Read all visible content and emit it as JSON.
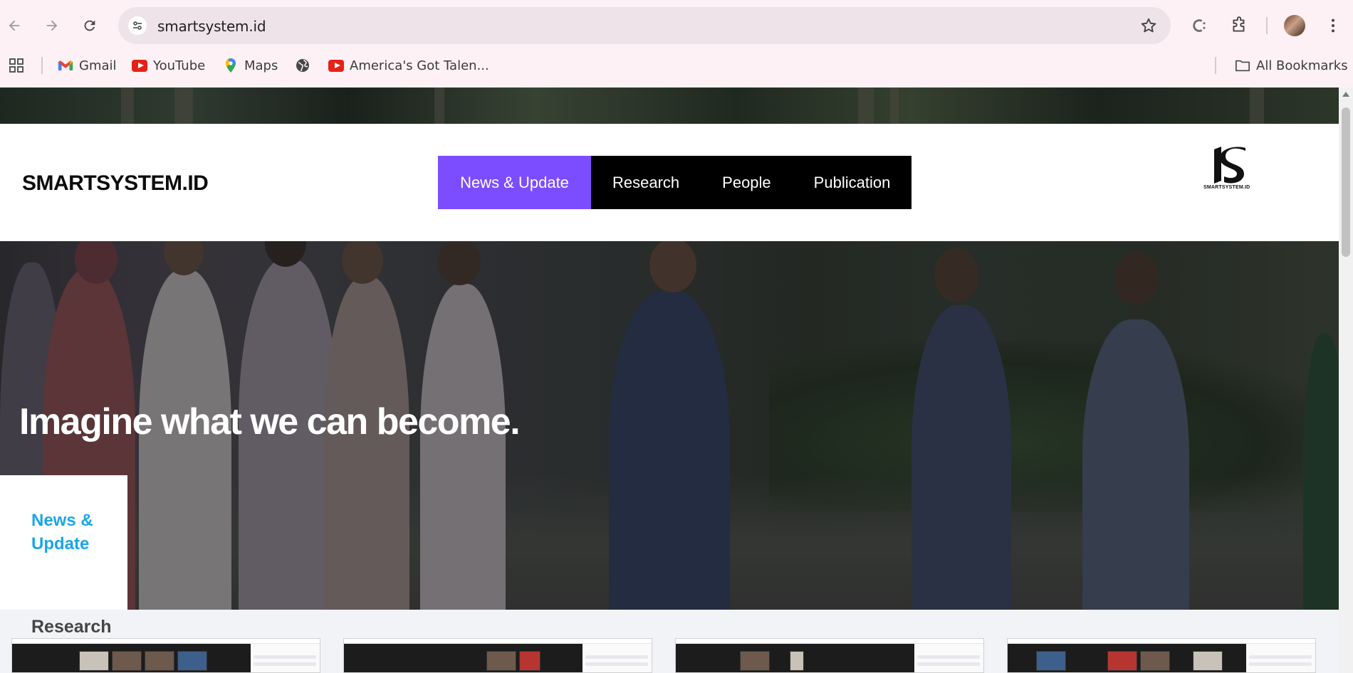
{
  "browser": {
    "url": "smartsystem.id",
    "bookmarks": [
      {
        "label": "Gmail",
        "icon": "gmail-icon"
      },
      {
        "label": "YouTube",
        "icon": "youtube-icon"
      },
      {
        "label": "Maps",
        "icon": "maps-icon"
      },
      {
        "label": "",
        "icon": "globe-icon"
      },
      {
        "label": "America's Got Talen...",
        "icon": "youtube-icon"
      }
    ],
    "all_bookmarks_label": "All Bookmarks"
  },
  "site": {
    "brand": "SMARTSYSTEM.ID",
    "logo_text": "SMARTSYSTEM.ID",
    "nav": [
      {
        "label": "News & Update",
        "active": true
      },
      {
        "label": "Research",
        "active": false
      },
      {
        "label": "People",
        "active": false
      },
      {
        "label": "Publication",
        "active": false
      }
    ],
    "accent_color": "#7c4dff",
    "link_color": "#1ba5e8"
  },
  "hero": {
    "title": "Imagine what we can become."
  },
  "side_card": {
    "title": "News & Update"
  },
  "research_section": {
    "label": "Research"
  }
}
